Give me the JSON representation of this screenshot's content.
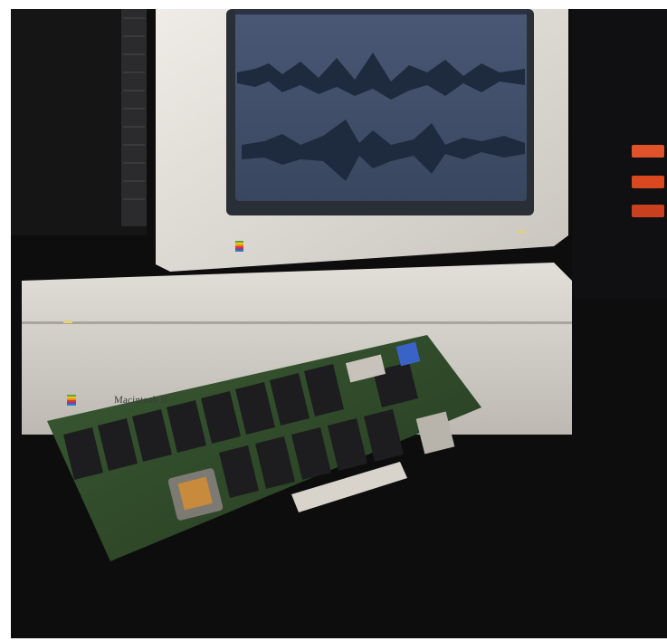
{
  "image": {
    "computer_label": "Macintosh II",
    "colors": {
      "background": "#0d0d0e",
      "monitor_bezel": "#e4e1dc",
      "screen": "#3f4d6a",
      "waveform": "#1e2a3e",
      "case": "#d9d6d0",
      "pcb": "#2f4a2a",
      "chips": "#1d1d20",
      "console": "#1b1c1f",
      "indicator_red": "#e0522a",
      "indicator_blue": "#3a63c8"
    }
  }
}
